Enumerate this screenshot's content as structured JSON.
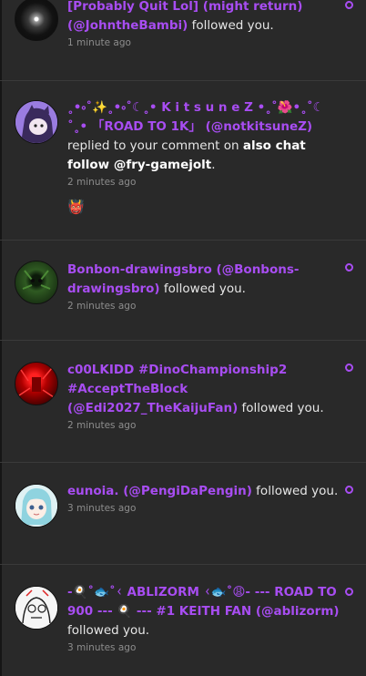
{
  "colors": {
    "background": "#191919",
    "card": "#292929",
    "accent": "#a84df2",
    "time": "#8d8d8d"
  },
  "notifications": [
    {
      "username": "[Probably Quit Lol] (might return) (@JohntheBambi)",
      "action": " followed you.",
      "time": "1 minute ago",
      "unread": true,
      "avatar_icon": "dark-glow-avatar"
    },
    {
      "username": "˳•༚˚✨˳•༚˚☾˳• K i t s u n e Z •˳˚🌺•˳˚☾ ˚˳• 「ROAD TO 1K」 (@notkitsuneZ)",
      "action": "replied to your comment on ",
      "target": "also chat follow @fry-gamejolt",
      "target_suffix": ".",
      "time": "2 minutes ago",
      "comment": "👹",
      "unread": false,
      "avatar_icon": "purple-character-avatar"
    },
    {
      "username": "Bonbon-drawingsbro (@Bonbons-drawingsbro)",
      "action": " followed you.",
      "time": "2 minutes ago",
      "unread": true,
      "avatar_icon": "green-creature-avatar"
    },
    {
      "username": "c00LKIDD #DinoChampionship2 #AcceptTheBlock (@Edi2027_TheKaijuFan)",
      "action": " followed you.",
      "time": "2 minutes ago",
      "unread": true,
      "avatar_icon": "red-figure-avatar"
    },
    {
      "username": "eunoia. (@PengiDaPengin)",
      "action": " followed you.",
      "time": "3 minutes ago",
      "unread": true,
      "avatar_icon": "anime-girl-avatar"
    },
    {
      "username": "-🍳˚🐟˚ᚲ ABLIZORM ᚲ🐟˚😩- --- ROAD TO 900 --- 🍳 --- #1 KEITH FAN (@ablizorm)",
      "action": " followed you.",
      "time": "3 minutes ago",
      "unread": true,
      "avatar_icon": "sketch-avatar"
    }
  ]
}
